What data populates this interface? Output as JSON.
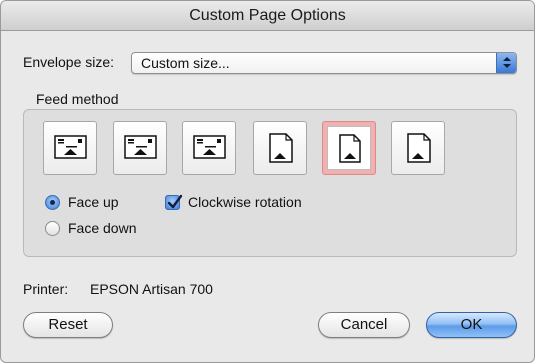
{
  "window": {
    "title": "Custom Page Options"
  },
  "envelope": {
    "label": "Envelope size:",
    "value": "Custom size..."
  },
  "feed_method": {
    "label": "Feed method",
    "options": [
      {
        "icon": "envelope-landscape-feed-icon",
        "selected": false
      },
      {
        "icon": "envelope-landscape-feed-icon",
        "selected": false
      },
      {
        "icon": "envelope-landscape-feed-icon",
        "selected": false
      },
      {
        "icon": "envelope-portrait-feed-icon",
        "selected": false
      },
      {
        "icon": "envelope-portrait-feed-icon",
        "selected": true
      },
      {
        "icon": "envelope-portrait-feed-icon",
        "selected": false
      }
    ]
  },
  "orientation": {
    "face_up": {
      "label": "Face up",
      "selected": true
    },
    "face_down": {
      "label": "Face down",
      "selected": false
    }
  },
  "rotation": {
    "label": "Clockwise rotation",
    "checked": true
  },
  "printer": {
    "label": "Printer:",
    "name": "EPSON Artisan 700"
  },
  "buttons": {
    "reset": "Reset",
    "cancel": "Cancel",
    "ok": "OK"
  },
  "colors": {
    "accent": "#5d9be8",
    "selection_highlight": "#f2b1b1"
  }
}
